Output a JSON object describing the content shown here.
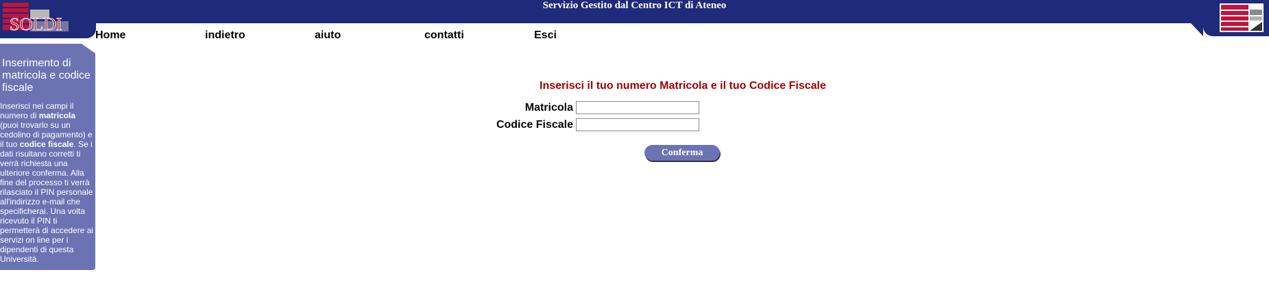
{
  "header": {
    "logo_text": "SOLDI",
    "banner_title": "Servizio Gestito dal Centro ICT di Ateneo"
  },
  "nav": {
    "items": [
      {
        "label": "Home"
      },
      {
        "label": "indietro"
      },
      {
        "label": "aiuto"
      },
      {
        "label": "contatti"
      },
      {
        "label": "Esci"
      }
    ]
  },
  "sidebar": {
    "title": "Inserimento di matricola e codice fiscale",
    "body": {
      "p1": "Inserisci nei campi il numero di ",
      "b1": "matricola",
      "p2": " (puoi trovarlo su un cedolino di pagamento) e il tuo ",
      "b2": "codice fiscale",
      "p3": ". Se i dati risultano corretti ti verrà richiesta una ulteriore conferma. Alla fine del processo ti verrà rilasciato il PIN personale all'indirizzo e-mail che specificherai. Una volta ricevuto il PIN ti permetterà di accedere ai servizi on line per i dipendenti di questa Università."
    }
  },
  "form": {
    "heading": "Inserisci il tuo numero Matricola e il tuo Codice Fiscale",
    "matricola_label": "Matricola",
    "matricola_value": "",
    "codice_label": "Codice Fiscale",
    "codice_value": "",
    "submit_label": "Conferma"
  },
  "colors": {
    "banner": "#1f2a7a",
    "sidebar": "#6b73b3",
    "heading": "#a00000",
    "logo_red": "#c0143c"
  },
  "icons": {
    "logo": "soldi-logo",
    "right_logo": "ateneo-logo"
  }
}
